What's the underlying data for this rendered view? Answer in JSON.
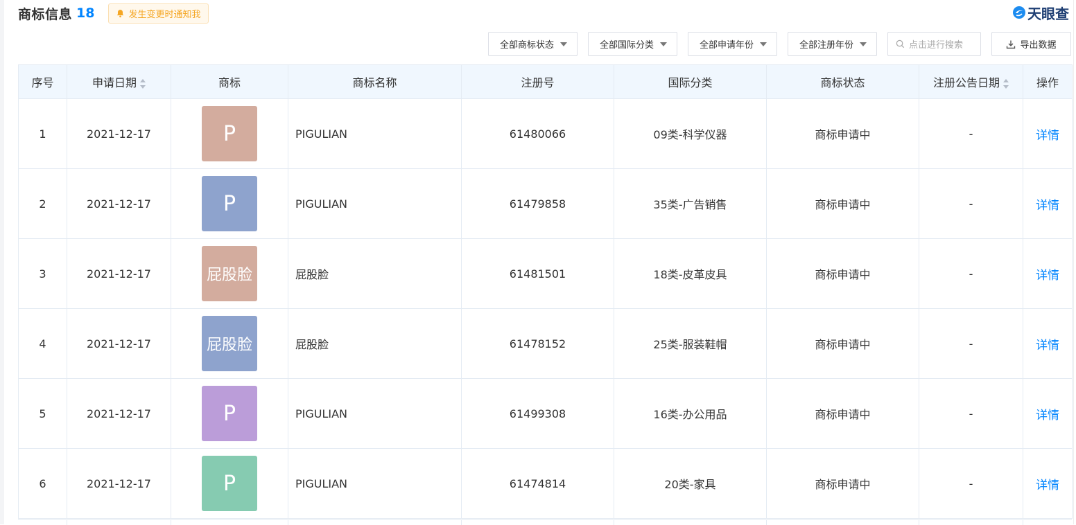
{
  "header": {
    "title": "商标信息",
    "count": "18",
    "notify_label": "发生变更时通知我",
    "brand": "天眼查"
  },
  "filters": {
    "status": "全部商标状态",
    "intl_class": "全部国际分类",
    "apply_year": "全部申请年份",
    "reg_year": "全部注册年份",
    "search_placeholder": "点击进行搜索",
    "export_label": "导出数据"
  },
  "table": {
    "columns": [
      "序号",
      "申请日期",
      "商标",
      "商标名称",
      "注册号",
      "国际分类",
      "商标状态",
      "注册公告日期",
      "操作"
    ],
    "rows": [
      {
        "index": "1",
        "date": "2021-12-17",
        "logo_text": "P",
        "logo_color": "#d3ac9e",
        "name": "PIGULIAN",
        "reg_no": "61480066",
        "class": "09类-科学仪器",
        "status": "商标申请中",
        "announce": "-",
        "action": "详情"
      },
      {
        "index": "2",
        "date": "2021-12-17",
        "logo_text": "P",
        "logo_color": "#8ea3cd",
        "name": "PIGULIAN",
        "reg_no": "61479858",
        "class": "35类-广告销售",
        "status": "商标申请中",
        "announce": "-",
        "action": "详情"
      },
      {
        "index": "3",
        "date": "2021-12-17",
        "logo_text": "屁股脸",
        "logo_color": "#d3ac9e",
        "name": "屁股脸",
        "reg_no": "61481501",
        "class": "18类-皮革皮具",
        "status": "商标申请中",
        "announce": "-",
        "action": "详情"
      },
      {
        "index": "4",
        "date": "2021-12-17",
        "logo_text": "屁股脸",
        "logo_color": "#8ea3cd",
        "name": "屁股脸",
        "reg_no": "61478152",
        "class": "25类-服装鞋帽",
        "status": "商标申请中",
        "announce": "-",
        "action": "详情"
      },
      {
        "index": "5",
        "date": "2021-12-17",
        "logo_text": "P",
        "logo_color": "#bb9dd9",
        "name": "PIGULIAN",
        "reg_no": "61499308",
        "class": "16类-办公用品",
        "status": "商标申请中",
        "announce": "-",
        "action": "详情"
      },
      {
        "index": "6",
        "date": "2021-12-17",
        "logo_text": "P",
        "logo_color": "#86cbb1",
        "name": "PIGULIAN",
        "reg_no": "61474814",
        "class": "20类-家具",
        "status": "商标申请中",
        "announce": "-",
        "action": "详情"
      }
    ]
  },
  "colors": {
    "accent": "#0084ff",
    "notify_text": "#f5a623",
    "header_bg": "#f0f7fe"
  },
  "icons": {
    "notify": "bell-icon",
    "brand": "tianyancha-logo-icon",
    "filter_caret": "caret-down-icon",
    "search": "search-icon",
    "export": "download-icon",
    "sort": "sort-icon"
  }
}
